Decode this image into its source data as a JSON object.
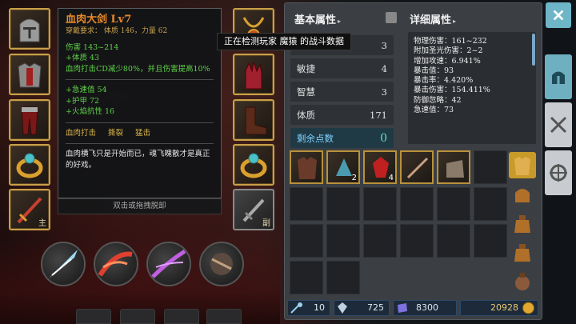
{
  "tooltip": {
    "name": "血肉大剑  Lv7",
    "requirement": "穿戴要求：  体质 146，力量 62",
    "damage": "伤害  143~214",
    "stats1": [
      "+体质 43",
      "血肉打击CD减少80%，并且伤害提高10%"
    ],
    "stats2": [
      "+急速值 54",
      "+护甲 72",
      "+火焰抗性 16"
    ],
    "skills": [
      "血肉打击",
      "撕裂",
      "猛击"
    ],
    "flavor": "血肉横飞只是开始而已，魂飞魄散才是真正的好戏。",
    "unequip_hint": "双击或拖拽脱卸"
  },
  "equipment": {
    "left": [
      {
        "name": "helmet",
        "tag": ""
      },
      {
        "name": "chest-armor",
        "tag": ""
      },
      {
        "name": "leg-armor",
        "tag": ""
      },
      {
        "name": "ring",
        "tag": ""
      },
      {
        "name": "main-hand-weapon",
        "tag": "主"
      }
    ],
    "right": [
      {
        "name": "amulet",
        "tag": ""
      },
      {
        "name": "gloves",
        "tag": ""
      },
      {
        "name": "boots",
        "tag": ""
      },
      {
        "name": "ring-2",
        "tag": ""
      },
      {
        "name": "off-hand-weapon",
        "tag": "副"
      }
    ]
  },
  "banner": "正在检测玩家 魔猿 的战斗数据",
  "basic": {
    "title": "基本属性",
    "rows": [
      {
        "label": "力量",
        "value": "3"
      },
      {
        "label": "敏捷",
        "value": "4"
      },
      {
        "label": "智慧",
        "value": "3"
      },
      {
        "label": "体质",
        "value": "171"
      }
    ],
    "remaining_label": "剩余点数",
    "remaining_value": "0"
  },
  "detail": {
    "title": "详细属性",
    "lines": [
      "物理伤害：161~232",
      "附加圣光伤害：2~2",
      "增加攻速：6.941%",
      "暴击值：93",
      "暴击率：4.420%",
      "暴击伤害：154.411%",
      "防御忽略：42",
      "急速值：73"
    ]
  },
  "inventory": {
    "items": [
      {
        "name": "armor-item",
        "count": ""
      },
      {
        "name": "ring-item",
        "count": "2"
      },
      {
        "name": "ruby-item",
        "count": "4"
      },
      {
        "name": "sword-item",
        "count": ""
      },
      {
        "name": "gauntlet-item",
        "count": ""
      }
    ]
  },
  "currency": {
    "keys": "10",
    "crystals": "725",
    "gems": "8300",
    "gold": "20928"
  },
  "colors": {
    "accent": "#c9a04a",
    "teal": "#6fb5c8",
    "green": "#5fd14a",
    "orange": "#e8892a"
  }
}
